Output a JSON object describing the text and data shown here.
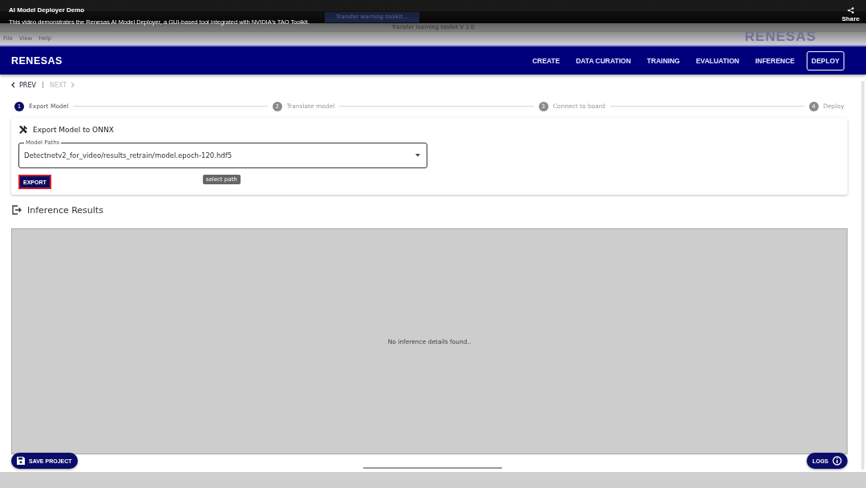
{
  "video": {
    "title": "AI Model Deployer Demo",
    "description": "This video demonstrates the Renesas AI Model Deployer, a GUI-based tool integrated with NVIDIA's TAO Toolkit.",
    "share": "Share"
  },
  "taskbar": {
    "task": "Transfer learning toolkit..."
  },
  "window": {
    "title": "Transfer learning toolkit V 1.0",
    "menu": [
      "File",
      "View",
      "Help"
    ],
    "logo": "RENESAS"
  },
  "app": {
    "logo": "RENESAS",
    "nav": [
      {
        "label": "CREATE",
        "selected": false
      },
      {
        "label": "DATA CURATION",
        "selected": false
      },
      {
        "label": "TRAINING",
        "selected": false
      },
      {
        "label": "EVALUATION",
        "selected": false
      },
      {
        "label": "INFERENCE",
        "selected": false
      },
      {
        "label": "DEPLOY",
        "selected": true
      }
    ],
    "pager": [
      {
        "label": "PREV",
        "disabled": false,
        "kind": "prev"
      },
      {
        "label": "NEXT",
        "disabled": true,
        "kind": "next"
      }
    ],
    "steps": [
      {
        "number": "1",
        "label": "Export Model",
        "active": true
      },
      {
        "number": "2",
        "label": "Translate model",
        "active": false
      },
      {
        "number": "3",
        "label": "Connect to board",
        "active": false
      },
      {
        "number": "4",
        "label": "Deploy",
        "active": false
      }
    ],
    "export_card": {
      "title": "Export Model to ONNX",
      "field": {
        "label": "Model Paths",
        "value": "Detectnetv2_for_video/results_retrain/model.epoch-120.hdf5"
      },
      "tooltip": "select path",
      "button": "EXPORT"
    },
    "results": {
      "title": "Inference Results",
      "empty": "No inference details found.."
    },
    "save_button": "SAVE PROJECT",
    "logs_button": "LOGS"
  }
}
